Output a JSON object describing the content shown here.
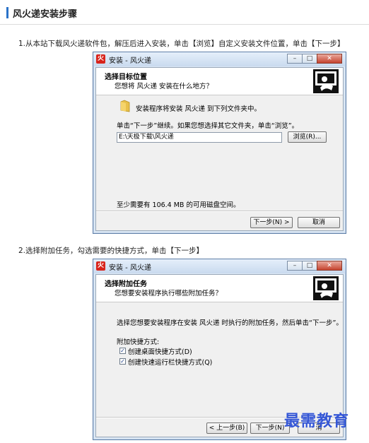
{
  "page": {
    "title": "风火递安装步骤"
  },
  "steps": [
    {
      "text": "1.从本站下载风火递软件包，解压后进入安装，单击【浏览】自定义安装文件位置，单击【下一步】"
    },
    {
      "text": "2.选择附加任务，勾选需要的快捷方式，单击【下一步】"
    }
  ],
  "window1": {
    "title": "安装 - 风火递",
    "header_title": "选择目标位置",
    "header_sub": "您想将 风火递 安装在什么地方？",
    "install_to": "安装程序将安装 风火递 到下列文件夹中。",
    "instruction": "单击“下一步”继续。如果您想选择其它文件夹，单击“浏览”。",
    "path": "E:\\天极下载\\风火递",
    "browse": "浏览(R)...",
    "space": "至少需要有 106.4 MB 的可用磁盘空间。",
    "next": "下一步(N) >",
    "cancel": "取消"
  },
  "window2": {
    "title": "安装 - 风火递",
    "header_title": "选择附加任务",
    "header_sub": "您想要安装程序执行哪些附加任务？",
    "instruction": "选择您想要安装程序在安装 风火递 时执行的附加任务，然后单击“下一步”。",
    "group": "附加快捷方式:",
    "options": [
      {
        "label": "创建桌面快捷方式(D)",
        "checked": true
      },
      {
        "label": "创建快速运行栏快捷方式(Q)",
        "checked": true
      }
    ],
    "back": "< 上一步(B)",
    "next": "下一步(N)",
    "cancel_partial": "消"
  },
  "icons": {
    "app": "fire-app-icon",
    "header": "computer-disk-icon",
    "folder": "folder-icon",
    "minimize": "minimize-icon",
    "maximize": "maximize-icon",
    "close": "close-icon"
  },
  "watermark": "最需教育"
}
